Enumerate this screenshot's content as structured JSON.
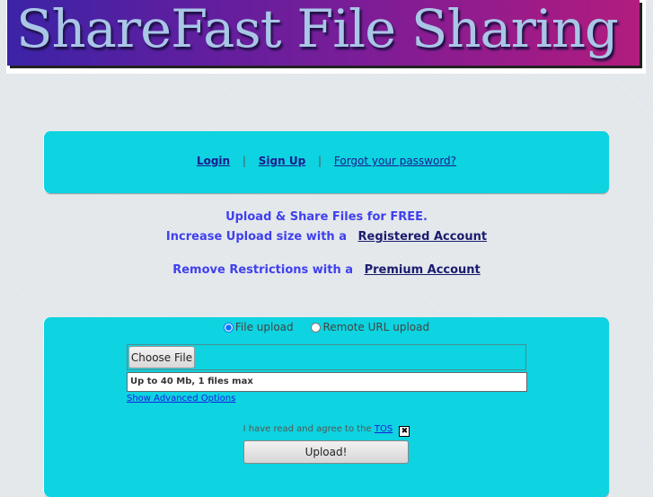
{
  "banner": {
    "title": "ShareFast File Sharing",
    "gradient": [
      "#3b23a6",
      "#b21d7e"
    ]
  },
  "nav": {
    "login": "Login",
    "separator": "|",
    "signup": "Sign Up",
    "forgot": "Forgot your password?"
  },
  "promo": {
    "line1": "Upload & Share Files for FREE.",
    "line2_text": "Increase Upload size with a",
    "line2_link": "Registered Account",
    "line3_text": "Remove Restrictions with a",
    "line3_link": "Premium Account"
  },
  "upload": {
    "mode_file": "File upload",
    "mode_url": "Remote URL upload",
    "selected_mode": "file",
    "choose_file": "Choose File",
    "limit": "Up to 40 Mb, 1 files max",
    "advanced": "Show Advanced Options",
    "tos_text": "I have read and agree to the",
    "tos_link": "TOS",
    "tos_checked": true,
    "tos_mark": "✖",
    "submit": "Upload!"
  },
  "colors": {
    "panel": "#0ed3e0",
    "promo": "#4040ee",
    "background": "#e1e6e9"
  }
}
